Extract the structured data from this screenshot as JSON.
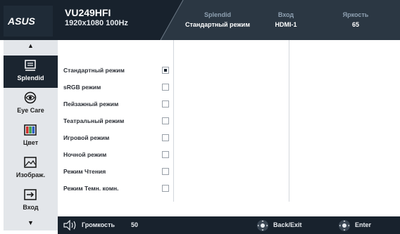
{
  "header": {
    "brand": "ASUS",
    "model": "VU249HFI",
    "resolution": "1920x1080 100Hz",
    "columns": [
      {
        "label": "Splendid",
        "value": "Стандартный режим"
      },
      {
        "label": "Вход",
        "value": "HDMI-1"
      },
      {
        "label": "Яркость",
        "value": "65"
      }
    ]
  },
  "nav": {
    "up_arrow": "▲",
    "down_arrow": "▼",
    "items": [
      {
        "label": "Splendid",
        "icon": "splendid-icon",
        "active": true
      },
      {
        "label": "Eye Care",
        "icon": "eye-care-icon",
        "active": false
      },
      {
        "label": "Цвет",
        "icon": "color-icon",
        "active": false
      },
      {
        "label": "Изображ.",
        "icon": "image-icon",
        "active": false
      },
      {
        "label": "Вход",
        "icon": "input-icon",
        "active": false
      }
    ]
  },
  "modes": [
    {
      "label": "Стандартный режим",
      "selected": true
    },
    {
      "label": "sRGB режим",
      "selected": false
    },
    {
      "label": "Пейзажный режим",
      "selected": false
    },
    {
      "label": "Театральный режим",
      "selected": false
    },
    {
      "label": "Игровой режим",
      "selected": false
    },
    {
      "label": "Ночной режим",
      "selected": false
    },
    {
      "label": "Режим Чтения",
      "selected": false
    },
    {
      "label": "Режим Темн. комн.",
      "selected": false
    }
  ],
  "bottom": {
    "volume_label": "Громкость",
    "volume_value": "50",
    "back_label": "Back/Exit",
    "enter_label": "Enter"
  },
  "colors": {
    "header_bg": "#18222d",
    "nav_bg": "#e3e6ea",
    "active_bg": "#1b2530"
  }
}
